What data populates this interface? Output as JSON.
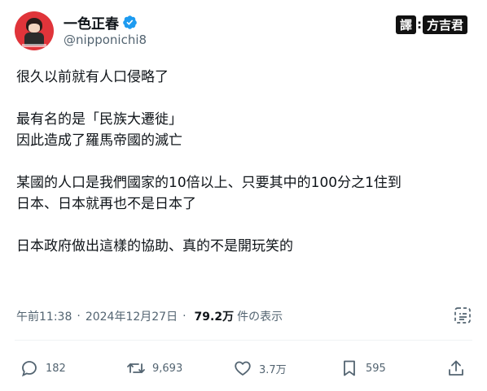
{
  "author": {
    "display_name": "一色正春",
    "handle": "@nipponichi8",
    "verified": true
  },
  "watermark": {
    "label": "譯",
    "colon": ":",
    "translator": "方吉君"
  },
  "tweet": {
    "paragraphs": [
      [
        "很久以前就有人口侵略了"
      ],
      [
        "最有名的是「民族大遷徙」",
        "因此造成了羅馬帝國的滅亡"
      ],
      [
        "某國的人口是我們國家的10倍以上、只要其中的100分之1住到",
        "日本、日本就再也不是日本了"
      ],
      [
        "日本政府做出這樣的協助、真的不是開玩笑的"
      ]
    ]
  },
  "meta": {
    "time": "午前11:38",
    "separator": "·",
    "date": "2024年12月27日",
    "views_count": "79.2万",
    "views_label": "件の表示"
  },
  "actions": {
    "replies": "182",
    "retweets": "9,693",
    "likes": "3.7万",
    "bookmarks": "595"
  },
  "icons": [
    "verified-icon",
    "grok-icon",
    "reply-icon",
    "retweet-icon",
    "like-icon",
    "bookmark-icon",
    "share-icon"
  ],
  "colors": {
    "verified": "#1d9bf0",
    "text": "#0f1419",
    "secondary": "#536471",
    "divider": "#eff3f4"
  }
}
